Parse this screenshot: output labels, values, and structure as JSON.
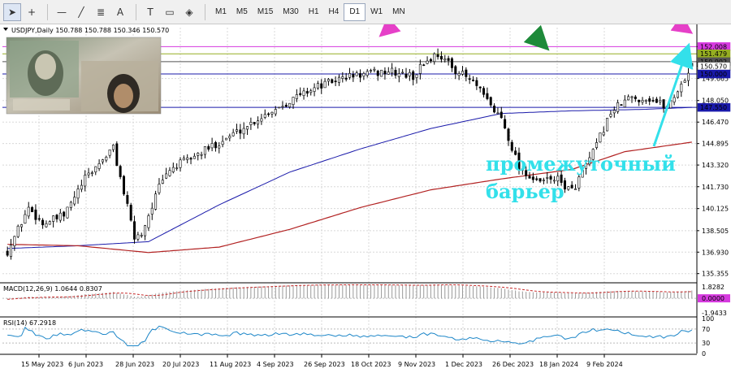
{
  "toolbar": {
    "tools": [
      {
        "name": "cursor",
        "icon": "arrow-cursor-icon",
        "glyph": "➤"
      },
      {
        "name": "crosshair",
        "icon": "crosshair-icon",
        "glyph": "+"
      },
      {
        "name": "hline",
        "icon": "horizontal-line-icon",
        "glyph": "—"
      },
      {
        "name": "trendline",
        "icon": "trend-line-icon",
        "glyph": "╱"
      },
      {
        "name": "fibo",
        "icon": "fibonacci-icon",
        "glyph": "≣"
      },
      {
        "name": "text",
        "icon": "text-tool-icon",
        "glyph": "A"
      },
      {
        "name": "label",
        "icon": "text-label-icon",
        "glyph": "T"
      },
      {
        "name": "rect",
        "icon": "rectangle-icon",
        "glyph": "▭"
      },
      {
        "name": "shapes",
        "icon": "shapes-icon",
        "glyph": "◈"
      }
    ],
    "timeframes": [
      "M1",
      "M5",
      "M15",
      "M30",
      "H1",
      "H4",
      "D1",
      "W1",
      "MN"
    ],
    "active_timeframe": "D1"
  },
  "header": {
    "symbol_line": "USDJPY,Daily  150.788 150.788 150.346 150.570"
  },
  "chart_data": {
    "type": "candlestick",
    "symbol": "USDJPY",
    "timeframe": "Daily",
    "ohlc_last": {
      "open": 150.788,
      "high": 150.788,
      "low": 150.346,
      "close": 150.57
    },
    "price_ticks": [
      152.008,
      150.57,
      149.665,
      148.05,
      146.47,
      144.895,
      143.32,
      141.73,
      140.125,
      138.505,
      136.93,
      135.355
    ],
    "ylim": [
      134.8,
      153.4
    ],
    "price_labels": [
      {
        "value": 152.008,
        "text": "152.008",
        "bg": "#d63adf",
        "fg": "#ffffff"
      },
      {
        "value": 151.479,
        "text": "151.479",
        "bg": "#95ad22",
        "fg": "#ffffff"
      },
      {
        "value": 150.902,
        "text": "150.902",
        "bg": "#555555",
        "fg": "#ffffff"
      },
      {
        "value": 150.57,
        "text": "150.570",
        "bg": "#ffffff",
        "fg": "#000000"
      },
      {
        "value": 150.0,
        "text": "150.000",
        "bg": "#1a1aaa",
        "fg": "#ffffff"
      },
      {
        "value": 147.55,
        "text": "147.550",
        "bg": "#1a1aaa",
        "fg": "#ffffff"
      }
    ],
    "horizontal_levels": [
      {
        "value": 152.008,
        "color": "#d63adf"
      },
      {
        "value": 151.479,
        "color": "#95ad22"
      },
      {
        "value": 150.902,
        "color": "#555555"
      },
      {
        "value": 150.0,
        "color": "#1a1aaa"
      },
      {
        "value": 147.55,
        "color": "#1a1aaa"
      }
    ],
    "date_ticks": [
      "15 May 2023",
      "6 Jun 2023",
      "28 Jun 2023",
      "20 Jul 2023",
      "11 Aug 2023",
      "4 Sep 2023",
      "26 Sep 2023",
      "18 Oct 2023",
      "9 Nov 2023",
      "1 Dec 2023",
      "26 Dec 2023",
      "18 Jan 2024",
      "9 Feb 2024"
    ],
    "close_anchors": [
      [
        0,
        137.0
      ],
      [
        6,
        140.2
      ],
      [
        10,
        139.0
      ],
      [
        16,
        139.6
      ],
      [
        22,
        142.3
      ],
      [
        30,
        144.6
      ],
      [
        36,
        138.0
      ],
      [
        38,
        138.3
      ],
      [
        43,
        141.7
      ],
      [
        46,
        143.0
      ],
      [
        56,
        144.4
      ],
      [
        66,
        145.9
      ],
      [
        74,
        147.2
      ],
      [
        86,
        148.9
      ],
      [
        96,
        149.8
      ],
      [
        108,
        150.2
      ],
      [
        115,
        149.8
      ],
      [
        118,
        150.8
      ],
      [
        122,
        151.5
      ],
      [
        126,
        150.5
      ],
      [
        132,
        149.4
      ],
      [
        138,
        147.3
      ],
      [
        140,
        146.8
      ],
      [
        145,
        143.2
      ],
      [
        150,
        142.0
      ],
      [
        155,
        142.4
      ],
      [
        160,
        141.4
      ],
      [
        166,
        144.2
      ],
      [
        171,
        147.2
      ],
      [
        176,
        148.2
      ],
      [
        182,
        148.2
      ],
      [
        187,
        147.6
      ],
      [
        190,
        148.8
      ],
      [
        194,
        150.57
      ]
    ],
    "ma_fast": [
      [
        0,
        137.2
      ],
      [
        20,
        137.4
      ],
      [
        40,
        137.7
      ],
      [
        60,
        140.4
      ],
      [
        80,
        142.8
      ],
      [
        100,
        144.5
      ],
      [
        120,
        146.0
      ],
      [
        140,
        147.1
      ],
      [
        160,
        147.3
      ],
      [
        180,
        147.4
      ],
      [
        194,
        147.55
      ]
    ],
    "ma_slow": [
      [
        0,
        137.5
      ],
      [
        20,
        137.4
      ],
      [
        40,
        136.9
      ],
      [
        60,
        137.3
      ],
      [
        80,
        138.6
      ],
      [
        100,
        140.2
      ],
      [
        120,
        141.5
      ],
      [
        140,
        142.3
      ],
      [
        160,
        143.0
      ],
      [
        175,
        144.3
      ],
      [
        194,
        145.0
      ]
    ],
    "candle_count": 195,
    "macd": {
      "label": "MACD(12,26,9) 1.0644 0.8307",
      "ticks": [
        "1.8282",
        "0.0000",
        "-1.9433"
      ]
    },
    "rsi": {
      "label": "RSI(14) 67.2918",
      "ticks": [
        "100",
        "70",
        "30",
        "0"
      ]
    },
    "annotation_text": [
      "промежуточный",
      "барьер"
    ],
    "colors": {
      "candle": "#000000",
      "ma_fast": "#1a1aaa",
      "ma_slow": "#b22222",
      "grid": "#d8d8d8",
      "annot_arrow_magenta": "#e640c8",
      "annot_arrow_green": "#1e8a3a",
      "annot_arrow_cyan": "#33e0ea",
      "annot_text": "#33e0ea",
      "macd_line": "#c62828",
      "rsi_line": "#1c86c8"
    }
  }
}
